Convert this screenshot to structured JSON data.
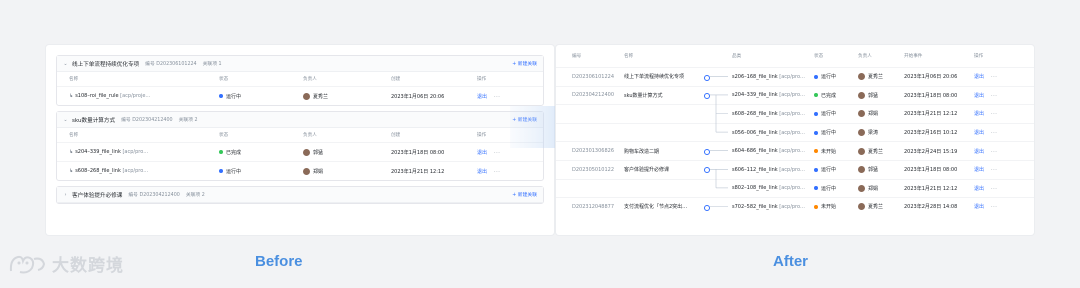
{
  "before": {
    "columns": [
      "名称",
      "状态",
      "负责人",
      "创建",
      "操作"
    ],
    "groups": [
      {
        "title": "线上下单流程持续优化专项",
        "code_label": "编号",
        "code": "D202306101224",
        "count_label": "关联项",
        "count": "1",
        "add_label": "+ 新建关联",
        "rows": [
          {
            "prefix": "↳",
            "link": "s108–roi_file_rule",
            "suffix": "[acp/proje…",
            "status": "运行中",
            "status_color": "#3370ff",
            "owner": "夏秀兰",
            "date": "2023年1月06日 20:06",
            "action": "退出",
            "more": "···"
          }
        ]
      },
      {
        "title": "sku数量计算方式",
        "code_label": "编号",
        "code": "D202304212400",
        "count_label": "关联项",
        "count": "2",
        "add_label": "+ 新建关联",
        "rows": [
          {
            "prefix": "↳",
            "link": "s204–339_file_link",
            "suffix": "[acp/pro…",
            "status": "已完成",
            "status_color": "#34c759",
            "owner": "郭猛",
            "date": "2023年1月18日 08:00",
            "action": "退出",
            "more": "···"
          },
          {
            "prefix": "↳",
            "link": "s608–268_file_link",
            "suffix": "[acp/pro…",
            "status": "运行中",
            "status_color": "#3370ff",
            "owner": "郑娟",
            "date": "2023年1月21日 12:12",
            "action": "退出",
            "more": "···"
          }
        ]
      },
      {
        "title": "客户体验提升必修课",
        "code_label": "编号",
        "code": "D202304212400",
        "count_label": "关联项",
        "count": "2",
        "add_label": "+ 新建关联",
        "rows": []
      }
    ]
  },
  "after": {
    "columns": [
      "编号",
      "名称",
      "品类",
      "状态",
      "负责人",
      "开始事件",
      "操作"
    ],
    "rows": [
      {
        "code": "D202306101224",
        "name": "线上下单流程持续优化专项",
        "link": "s206–168_file_link",
        "suffix": "[acp/pro…",
        "status": "运行中",
        "status_color": "#3370ff",
        "owner": "夏秀兰",
        "date": "2023年1月06日 20:06",
        "action": "退出",
        "more": "···"
      },
      {
        "code": "D202304212400",
        "name": "sku数量计算方式",
        "link": "s204–339_file_link",
        "suffix": "[acp/pro…",
        "status": "已完成",
        "status_color": "#34c759",
        "owner": "郭猛",
        "date": "2023年1月18日 08:00",
        "action": "退出",
        "more": "···"
      },
      {
        "code": "",
        "name": "",
        "link": "s608–268_file_link",
        "suffix": "[acp/pro…",
        "status": "运行中",
        "status_color": "#3370ff",
        "owner": "郑娟",
        "date": "2023年1月21日 12:12",
        "action": "退出",
        "more": "···"
      },
      {
        "code": "",
        "name": "",
        "link": "s056–006_file_link",
        "suffix": "[acp/pro…",
        "status": "运行中",
        "status_color": "#3370ff",
        "owner": "梁涛",
        "date": "2023年2月16日 10:12",
        "action": "退出",
        "more": "···"
      },
      {
        "code": "D202301306826",
        "name": "购物车改造二期",
        "link": "s604–686_file_link",
        "suffix": "[acp/pro…",
        "status": "未开始",
        "status_color": "#ff8800",
        "owner": "夏秀兰",
        "date": "2023年2月24日 15:19",
        "action": "退出",
        "more": "···"
      },
      {
        "code": "D202305010122",
        "name": "客户体验提升必修课",
        "link": "s606–112_file_link",
        "suffix": "[acp/pro…",
        "status": "运行中",
        "status_color": "#3370ff",
        "owner": "郭猛",
        "date": "2023年1月18日 08:00",
        "action": "退出",
        "more": "···"
      },
      {
        "code": "",
        "name": "",
        "link": "s802–108_file_link",
        "suffix": "[acp/pro…",
        "status": "运行中",
        "status_color": "#3370ff",
        "owner": "郑娟",
        "date": "2023年1月21日 12:12",
        "action": "退出",
        "more": "···"
      },
      {
        "code": "D202312048877",
        "name": "支付流程优化「节点2突出…",
        "link": "s702–582_file_link",
        "suffix": "[acp/pro…",
        "status": "未开始",
        "status_color": "#ff8800",
        "owner": "夏秀兰",
        "date": "2023年2月28日 14:08",
        "action": "退出",
        "more": "···"
      }
    ]
  },
  "captions": {
    "before": "Before",
    "after": "After"
  },
  "logo": {
    "text": "大数跨境"
  }
}
